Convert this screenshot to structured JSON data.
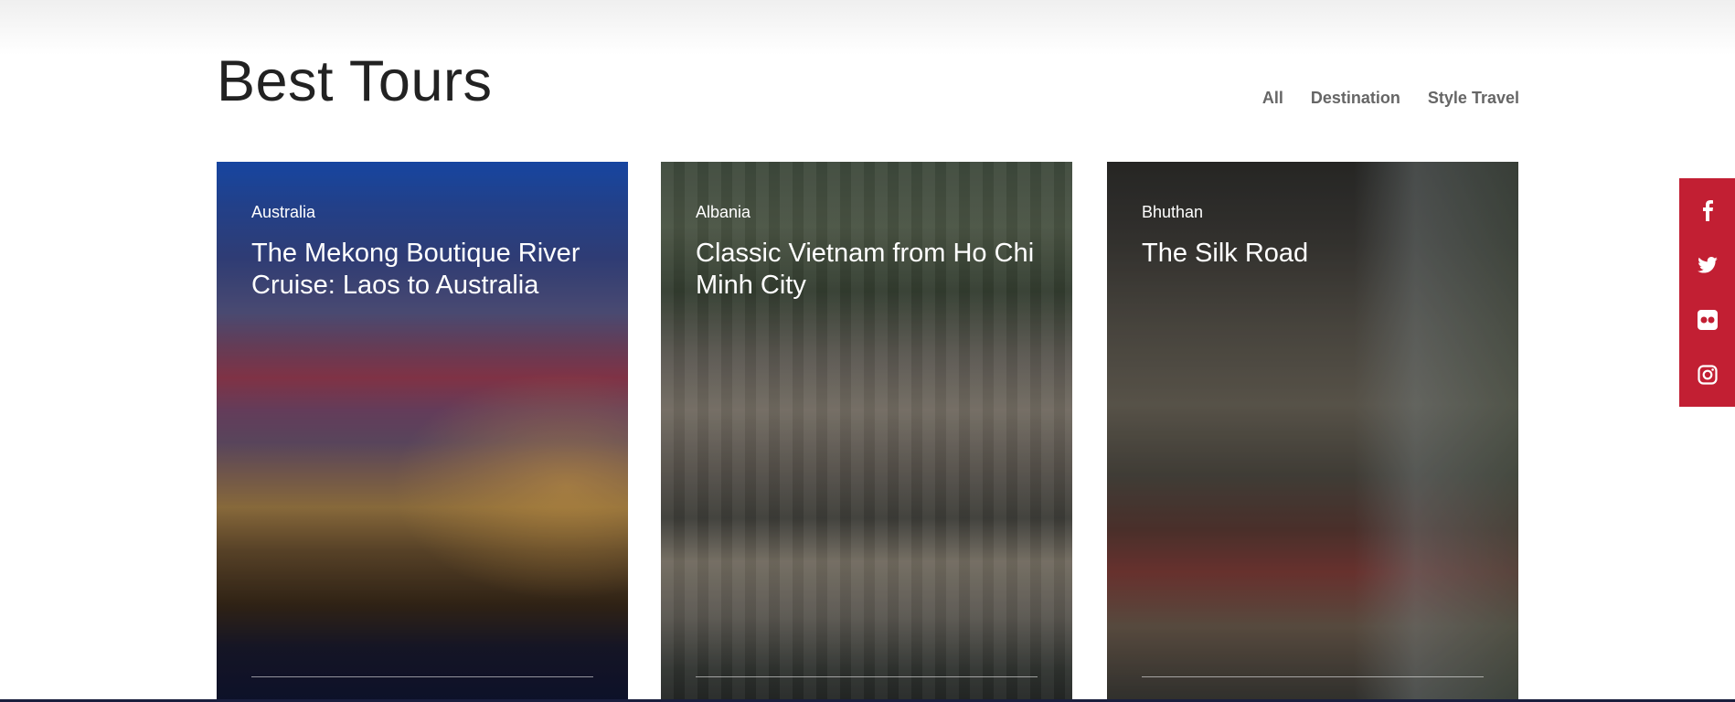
{
  "section": {
    "title": "Best Tours"
  },
  "filters": [
    {
      "label": "All"
    },
    {
      "label": "Destination"
    },
    {
      "label": "Style Travel"
    }
  ],
  "tours": [
    {
      "location": "Australia",
      "title": "The Mekong Boutique River Cruise: Laos to Australia"
    },
    {
      "location": "Albania",
      "title": "Classic Vietnam from Ho Chi Minh City"
    },
    {
      "location": "Bhuthan",
      "title": "The Silk Road"
    }
  ],
  "social": [
    {
      "icon": "facebook-icon"
    },
    {
      "icon": "twitter-icon"
    },
    {
      "icon": "flickr-icon"
    },
    {
      "icon": "instagram-icon"
    }
  ],
  "colors": {
    "social_bar": "#c21f33",
    "title_text": "#222222",
    "filter_text": "#666666"
  }
}
